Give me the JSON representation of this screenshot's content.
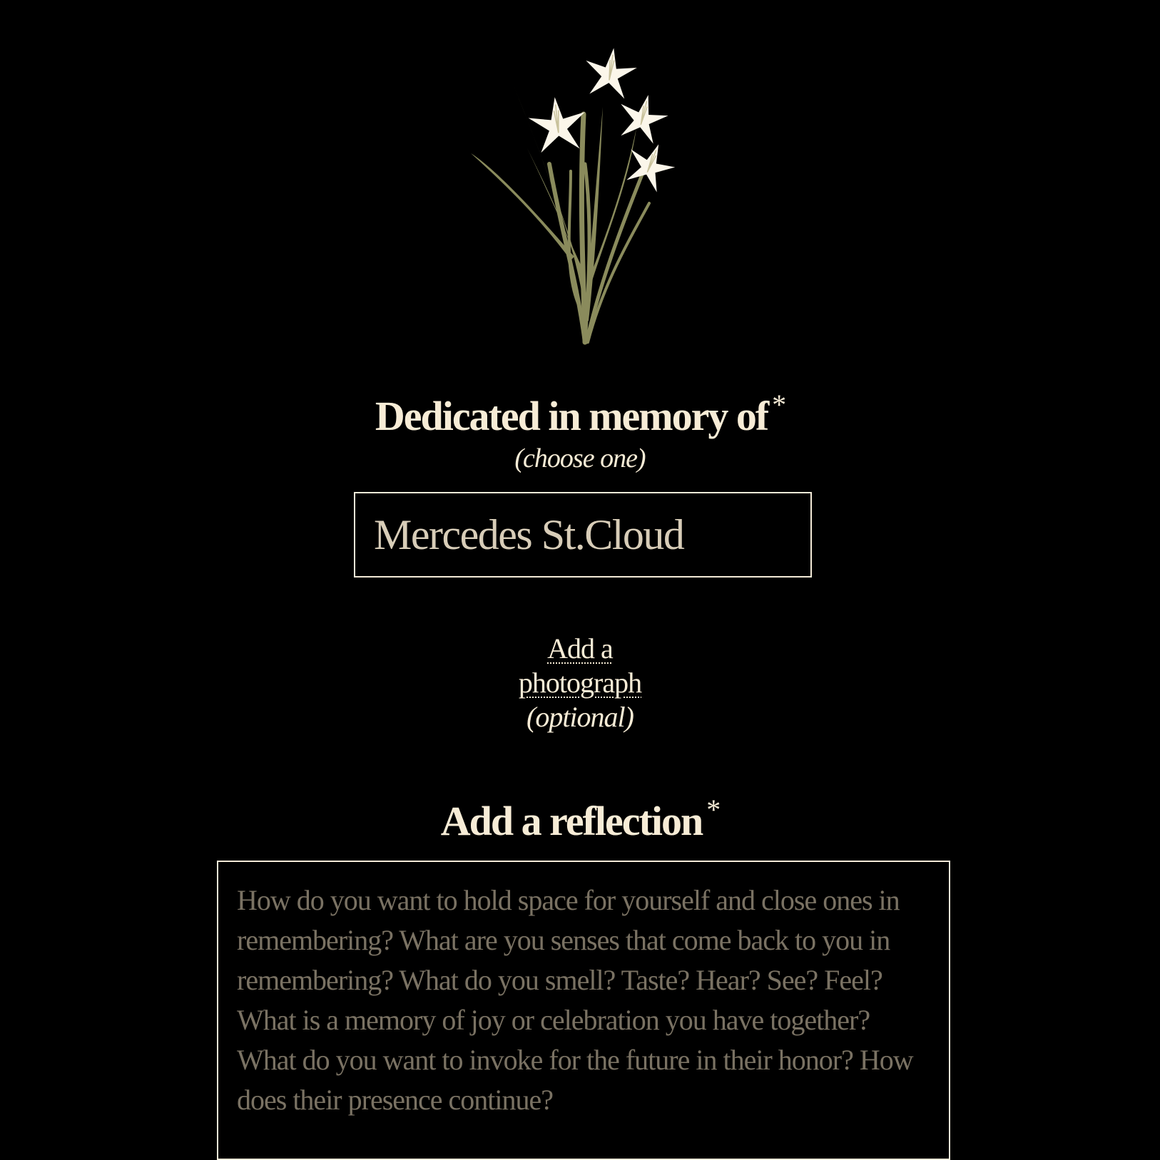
{
  "icons": {
    "header_illustration": "star-lily-bouquet-icon"
  },
  "colors": {
    "background": "#000000",
    "text": "#f7ecd6",
    "petal": "#fbf6ea",
    "stem": "#8a8b5c",
    "placeholder": "#7a7263",
    "border": "#f3ead8"
  },
  "dedication": {
    "heading": "Dedicated in memory of",
    "required_mark": "*",
    "hint": "(choose one)",
    "name_value": "Mercedes St.Cloud"
  },
  "photo": {
    "link_label": "Add a photograph",
    "hint": "(optional)"
  },
  "reflection": {
    "heading": "Add a reflection",
    "required_mark": "*",
    "placeholder": "How do you want to hold space for yourself and close ones in remembering? What are you senses that come back to you in remembering? What do you smell? Taste? Hear? See? Feel? What is a memory of joy or celebration you have together? What do you want to invoke for the future in their honor? How does their presence continue?"
  }
}
